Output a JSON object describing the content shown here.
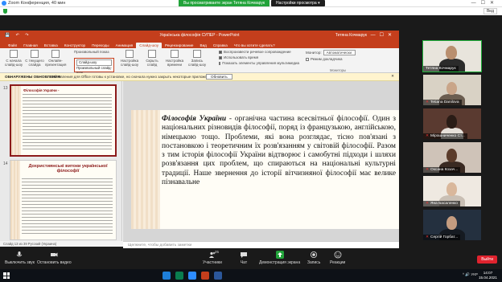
{
  "zoom": {
    "window_title": "Zoom Конференция, 40 мин",
    "share_banner": "Вы просматриваете экран Тетяна Кочмарук",
    "view_options": "Настройки просмотра ▾",
    "view_button": "Вид"
  },
  "powerpoint": {
    "title": "Українська філософія СУПЕР - PowerPoint",
    "user": "Тетяна Кочмарук",
    "quick_access": "💾 ↶ ↷",
    "tabs": [
      "Файл",
      "Главная",
      "Вставка",
      "Конструктор",
      "Переходы",
      "Анимация",
      "Слайд-шоу",
      "Рецензирование",
      "Вид",
      "Справка",
      "Что вы хотите сделать?"
    ],
    "active_tab": "Слайд-шоу",
    "ribbon": {
      "from_start": "С начала слайд-шоу",
      "from_current": "С текущего слайда",
      "present_online": "Онлайн-презентация",
      "custom_show": "Произвольный показ",
      "group_start": "Начать слайд-шоу",
      "dropdown_selected": "Слайд-шоу",
      "dropdown_hint": "Произвольный слайд-шоу",
      "setup": "Настройка слайд-шоу",
      "hide_slide": "Скрыть слайд",
      "rehearse": "Настройка времени",
      "record": "Запись слайд-шоу",
      "chk_narration": "Воспроизвести речевое сопровождение",
      "chk_timings": "Использовать время",
      "chk_controls": "Показать элементы управления мультимедиа",
      "monitor_label": "Монитор:",
      "monitor_value": "Автоматически",
      "presenter_view": "Режим докладчика",
      "group_monitors": "Мониторы"
    },
    "notice_label": "ОБНАРУЖЕНЫ ОБНОВЛЕНИЯ",
    "notice_text": "Обновления для Office готовы к установке, но сначала нужно закрыть некоторые приложения.",
    "notice_button": "Обновить",
    "thumb1_number": "13",
    "thumb1_lead": "Філософія України -",
    "thumb2_number": "14",
    "thumb2_title": "Дохристиянські витоки української філософії",
    "slide_lead": "Філософія України",
    "slide_body": " - органічна частина всесвітньої філософії. Один з національних різновидів філософії, поряд із французькою, англійською, німецькою тощо. Проблеми, які вона розглядає, тісно пов'язані з постановкою і теоретичним їх розв'язанням у світовій філософії. Разом з тим історія філософії України відтворює і самобутні підходи і шляхи розв'язання цих проблем, що спираються на національні культурні традиції. Наше звернення до історії вітчизняної філософії має велике пізнавальне",
    "notes_placeholder": "Щелкните, чтобы добавить заметки",
    "status": "Слайд 13 из 39   Русский (Украина)"
  },
  "participants": [
    {
      "name": "Тетяна Кочмарук",
      "muted": false
    },
    {
      "name": "Tetiana Danilova",
      "muted": true
    },
    {
      "name": "Мірошниченко Ст...",
      "muted": true
    },
    {
      "name": "Оксана Козач...",
      "muted": true
    },
    {
      "name": "Яна Басаленко",
      "muted": true
    },
    {
      "name": "Сергій Горбат...",
      "muted": true
    }
  ],
  "toolbar": {
    "unmute": "Выключить звук",
    "stop_video": "Остановить видео",
    "participants": "Участники",
    "participants_count": "25",
    "chat": "Чат",
    "share_screen": "Демонстрация экрана",
    "record": "Запись",
    "reactions": "Реакции",
    "end": "Выйти"
  },
  "taskbar": {
    "tray": "^  🔊  УКР",
    "time": "14:07",
    "date": "15.04.2021"
  },
  "colors": {
    "ppt_accent": "#c43e1c",
    "zoom_green": "#22a33a",
    "end_red": "#e0232e"
  }
}
